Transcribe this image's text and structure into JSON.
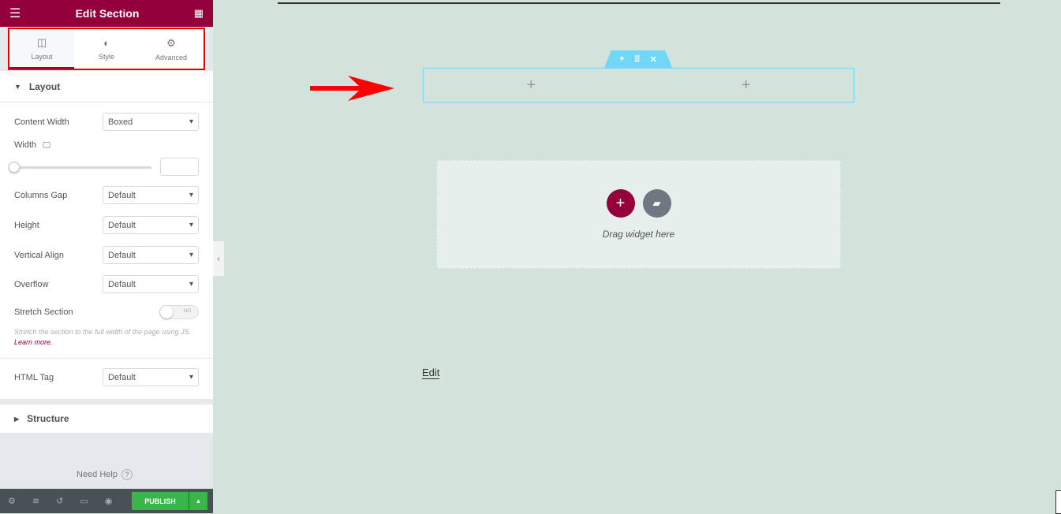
{
  "header": {
    "title": "Edit Section",
    "menu_icon": "hamburger-icon",
    "apps_icon": "grid-icon"
  },
  "tabs": [
    {
      "label": "Layout",
      "icon": "columns-icon"
    },
    {
      "label": "Style",
      "icon": "contrast-icon"
    },
    {
      "label": "Advanced",
      "icon": "gear-icon"
    }
  ],
  "layout": {
    "title": "Layout",
    "content_width": {
      "label": "Content Width",
      "value": "Boxed"
    },
    "width": {
      "label": "Width",
      "value": ""
    },
    "columns_gap": {
      "label": "Columns Gap",
      "value": "Default"
    },
    "height": {
      "label": "Height",
      "value": "Default"
    },
    "vertical_align": {
      "label": "Vertical Align",
      "value": "Default"
    },
    "overflow": {
      "label": "Overflow",
      "value": "Default"
    },
    "stretch": {
      "label": "Stretch Section",
      "toggle": "NO",
      "help": "Stretch the section to the full width of the page using JS.",
      "link": "Learn more."
    },
    "html_tag": {
      "label": "HTML Tag",
      "value": "Default"
    }
  },
  "structure": {
    "title": "Structure"
  },
  "need_help": "Need Help",
  "footer": {
    "publish": "PUBLISH"
  },
  "canvas": {
    "drag_text": "Drag widget here",
    "edit_link": "Edit"
  },
  "colors": {
    "brand": "#93003c",
    "publish": "#39b54a",
    "handle": "#71d7f7"
  }
}
